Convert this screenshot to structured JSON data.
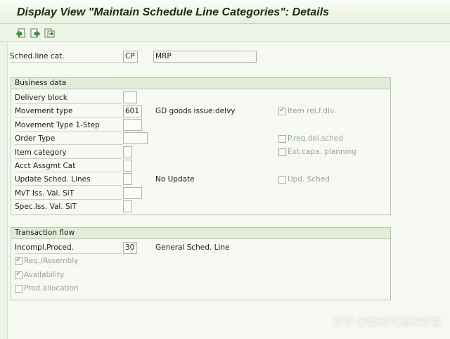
{
  "window": {
    "title": "Display View \"Maintain Schedule Line Categories\": Details"
  },
  "toolbar": {
    "icons": [
      "previous-entry-icon",
      "next-entry-icon",
      "other-entry-icon"
    ]
  },
  "header": {
    "sched_line_cat_label": "Sched.line cat.",
    "sched_line_cat_value": "CP",
    "description_value": "MRP"
  },
  "business_data": {
    "title": "Business data",
    "rows": {
      "delivery_block": {
        "label": "Delivery block",
        "value": ""
      },
      "movement_type": {
        "label": "Movement type",
        "value": "601",
        "text": "GD goods issue:delvy"
      },
      "movement_type_1step": {
        "label": "Movement Type 1-Step",
        "value": ""
      },
      "order_type": {
        "label": "Order Type",
        "value": ""
      },
      "item_category": {
        "label": "Item category",
        "value": ""
      },
      "acct_assgmt_cat": {
        "label": "Acct Assgmt Cat",
        "value": ""
      },
      "update_sched_lines": {
        "label": "Update Sched. Lines",
        "value": "",
        "text": "No Update"
      },
      "mvt_iss_val_sit": {
        "label": "MvT Iss. Val. SiT",
        "value": ""
      },
      "spec_iss_val_sit": {
        "label": "Spec.Iss. Val. SiT",
        "value": ""
      }
    },
    "checkboxes": {
      "item_rel_f_dlv": {
        "label": "Item rel.f.dlv.",
        "checked": true
      },
      "p_req_del_sched": {
        "label": "P.req.del.sched",
        "checked": false
      },
      "ext_capa_planning": {
        "label": "Ext.capa. planning",
        "checked": false
      },
      "upd_sched": {
        "label": "Upd. Sched",
        "checked": false
      }
    }
  },
  "transaction_flow": {
    "title": "Transaction flow",
    "incompl_proced_label": "Incompl.Proced.",
    "incompl_proced_value": "30",
    "incompl_proced_text": "General Sched. Line",
    "checkboxes": {
      "req_assembly": {
        "label": "Req./Assembly",
        "checked": true
      },
      "availability": {
        "label": "Availability",
        "checked": true
      },
      "prod_allocation": {
        "label": "Prod.allocation",
        "checked": false
      }
    }
  },
  "watermark": "知乎 @黄阁天涯的虾客"
}
